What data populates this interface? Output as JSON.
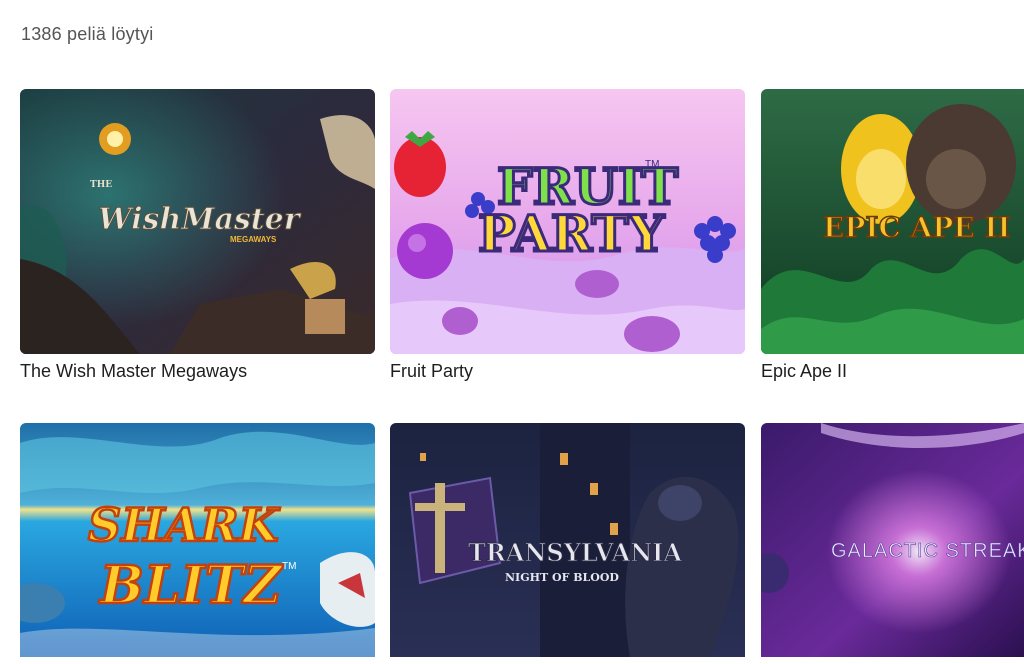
{
  "results": {
    "text": "1386 peliä löytyi"
  },
  "games": [
    {
      "title": "The Wish Master Megaways",
      "logo_small": "THE",
      "logo_main": "WishMaster",
      "logo_sub": "MEGAWAYS"
    },
    {
      "title": "Fruit Party",
      "logo_line1": "FRUIT",
      "logo_line2": "PARTY",
      "logo_tm": "TM"
    },
    {
      "title": "Epic Ape II",
      "logo_main": "EPIC APE II"
    },
    {
      "title": "",
      "logo_line1": "SHARK",
      "logo_line2": "BLITZ",
      "logo_tm": "TM"
    },
    {
      "title": "",
      "logo_main": "TRANSYLVANIA",
      "logo_sub": "NIGHT OF BLOOD"
    },
    {
      "title": "",
      "logo_main": "GALACTIC STREAK"
    }
  ],
  "colors": {
    "text_primary": "#1e1e1e",
    "text_muted": "#555555",
    "background": "#ffffff"
  }
}
